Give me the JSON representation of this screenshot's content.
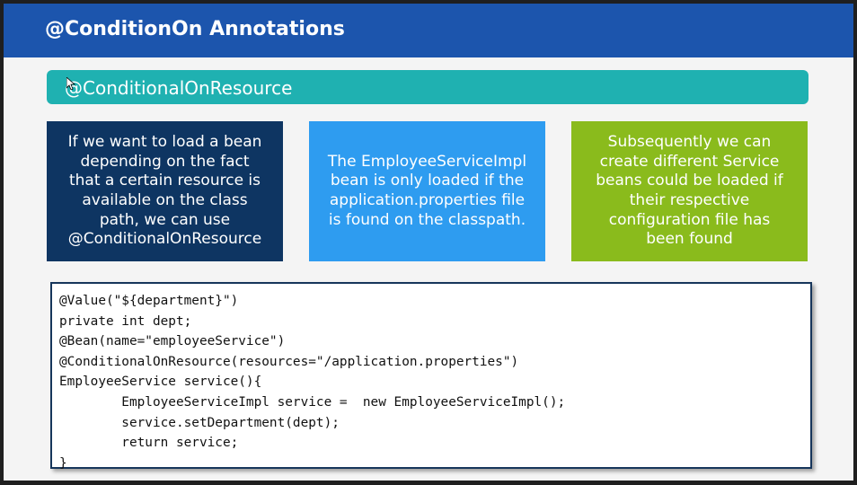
{
  "slide": {
    "title": "@ConditionOn Annotations",
    "subtitle": "@ConditionalOnResource",
    "boxes": [
      {
        "text": "If we want to load a bean\ndepending on the fact\nthat a certain resource is\navailable on the class\npath, we can use\n@ConditionalOnResource"
      },
      {
        "text": "The EmployeeServiceImpl\nbean is only loaded if the\napplication.properties file\nis found on the classpath."
      },
      {
        "text": "Subsequently we can\ncreate different Service\nbeans could be loaded if\ntheir respective\nconfiguration file has\nbeen found"
      }
    ],
    "code": "@Value(\"${department}\")\nprivate int dept;\n@Bean(name=\"employeeService\")\n@ConditionalOnResource(resources=\"/application.properties\")\nEmployeeService service(){\n        EmployeeServiceImpl service =  new EmployeeServiceImpl();\n        service.setDepartment(dept);\n        return service;\n}"
  },
  "colors": {
    "title_bar": "#1c55ad",
    "subtitle_bar": "#1fb1b1",
    "box1": "#0e3562",
    "box2": "#2e9cf0",
    "box3": "#8abb1c"
  },
  "icons": {
    "cursor": "mouse-pointer-icon"
  }
}
